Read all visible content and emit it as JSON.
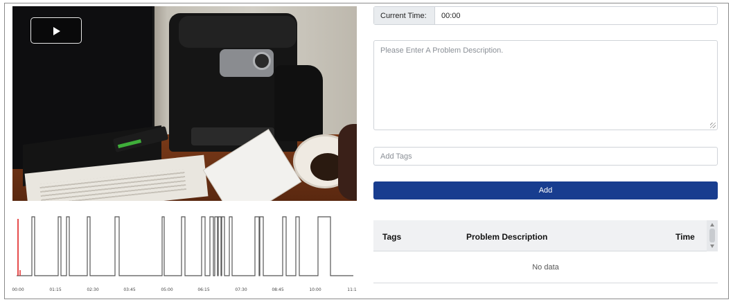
{
  "video": {
    "play_label": "play",
    "play_icon": "play-icon"
  },
  "timeline": {
    "tick_labels": [
      "00:00",
      "01:15",
      "02:30",
      "03:45",
      "05:00",
      "06:15",
      "07:30",
      "08:45",
      "10:00",
      "11:1"
    ],
    "playhead_color": "#e02020",
    "pulse_color": "#555555"
  },
  "form": {
    "current_time_label": "Current Time:",
    "current_time_value": "00:00",
    "description_placeholder": "Please Enter A Problem Description.",
    "tags_placeholder": "Add Tags",
    "add_label": "Add",
    "add_color": "#183d8f"
  },
  "table": {
    "columns": [
      "Tags",
      "Problem Description",
      "Time"
    ],
    "empty_text": "No data"
  }
}
